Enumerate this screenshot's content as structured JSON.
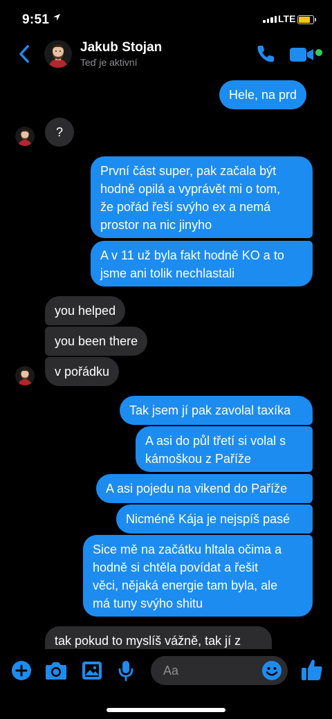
{
  "status_bar": {
    "time": "9:51",
    "network": "LTE",
    "battery_color": "#f5c518"
  },
  "header": {
    "contact_name": "Jakub Stojan",
    "contact_status": "Teď je aktivní",
    "accent": "#1d8cf0",
    "online_color": "#30d158",
    "icons": [
      "chevron-left-icon",
      "phone-icon",
      "video-camera-icon"
    ]
  },
  "messages": [
    {
      "sender": "me",
      "text": "Hele, na prd"
    },
    {
      "sender": "contact",
      "text": "?"
    },
    {
      "sender": "me",
      "text": "První část super, pak začala být\nhodně opilá a vyprávět mi o tom,\nže pořád řeší svýho ex a nemá\nprostor na nic jinyho"
    },
    {
      "sender": "me",
      "text": "A v 11 už byla fakt hodně KO a to\njsme ani tolik nechlastali"
    },
    {
      "sender": "contact",
      "text": "you helped"
    },
    {
      "sender": "contact",
      "text": "you been there"
    },
    {
      "sender": "contact",
      "text": "v pořádku"
    },
    {
      "sender": "me",
      "text": "Tak jsem jí pak zavolal taxíka"
    },
    {
      "sender": "me",
      "text": "A asi do půl třetí si volal s\nkámoškou z Paříže"
    },
    {
      "sender": "me",
      "text": "A asi pojedu na vikend do Paříže"
    },
    {
      "sender": "me",
      "text": "Nicméně Kája je nejspíš pasé"
    },
    {
      "sender": "me",
      "text": "Sice mě na začátku hltala očima a\nhodně si chtěla povídat a řešit\nvěci, nějaká energie tam byla, ale\nmá tuny svýho shitu"
    },
    {
      "sender": "contact",
      "text": "tak pokud to myslíš vážně, tak jí z"
    }
  ],
  "composer": {
    "placeholder": "Aa",
    "icons": [
      "plus-icon",
      "camera-icon",
      "gallery-icon",
      "microphone-icon",
      "emoji-icon",
      "thumbs-up-icon"
    ]
  }
}
